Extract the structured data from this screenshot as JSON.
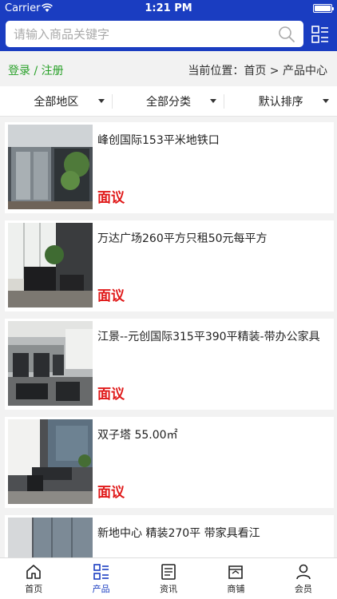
{
  "status_bar": {
    "carrier": "Carrier",
    "time": "1:21 PM"
  },
  "search": {
    "placeholder": "请输入商品关键字",
    "value": ""
  },
  "auth": {
    "login": "登录",
    "separator": " / ",
    "register": "注册"
  },
  "breadcrumb": {
    "prefix": "当前位置：",
    "home": "首页",
    "arrow": " > ",
    "current": "产品中心"
  },
  "filters": [
    {
      "label": "全部地区"
    },
    {
      "label": "全部分类"
    },
    {
      "label": "默认排序"
    }
  ],
  "products": [
    {
      "title": "峰创国际153平米地铁口",
      "price": "面议"
    },
    {
      "title": "万达广场260平方只租50元每平方",
      "price": "面议"
    },
    {
      "title": "江景--元创国际315平390平精装-带办公家具",
      "price": "面议"
    },
    {
      "title": "双子塔 55.00㎡",
      "price": "面议"
    },
    {
      "title": "新地中心 精装270平 带家具看江",
      "price": ""
    }
  ],
  "tabs": [
    {
      "label": "首页",
      "icon": "home-icon"
    },
    {
      "label": "产品",
      "icon": "product-list-icon",
      "active": true
    },
    {
      "label": "资讯",
      "icon": "news-icon"
    },
    {
      "label": "商铺",
      "icon": "store-icon"
    },
    {
      "label": "会员",
      "icon": "member-icon"
    }
  ],
  "colors": {
    "brand": "#1a3dc1",
    "price": "#e01818",
    "login_link": "#2aa12a"
  }
}
